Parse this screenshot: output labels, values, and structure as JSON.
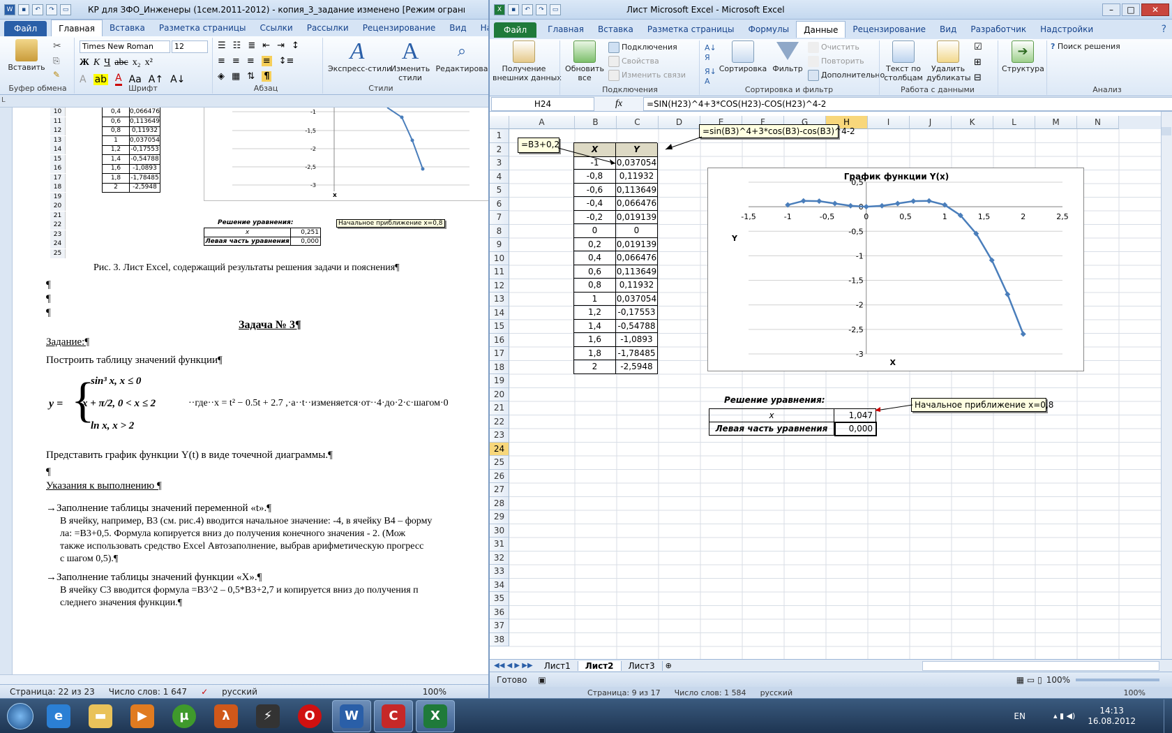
{
  "word": {
    "title": "КР для ЗФО_Инженеры (1сем.2011-2012) - копия_3_задание изменено [Режим ограниченной ...",
    "tabs": [
      "Файл",
      "Главная",
      "Вставка",
      "Разметка страницы",
      "Ссылки",
      "Рассылки",
      "Рецензирование",
      "Вид",
      "Надстр"
    ],
    "ribbon": {
      "paste": "Вставить",
      "clipboard": "Буфер обмена",
      "font_name": "Times New Roman",
      "font_size": "12",
      "font_group": "Шрифт",
      "para_group": "Абзац",
      "styles_group": "Стили",
      "express_styles": "Экспресс-стили",
      "change_styles_l1": "Изменить",
      "change_styles_l2": "стили",
      "editing": "Редактирова"
    },
    "mini_table": [
      [
        "10",
        "0,4",
        "0,066476"
      ],
      [
        "11",
        "0,6",
        "0,113649"
      ],
      [
        "12",
        "0,8",
        "0,11932"
      ],
      [
        "13",
        "1",
        "0,037054"
      ],
      [
        "14",
        "1,2",
        "-0,17553"
      ],
      [
        "15",
        "1,4",
        "-0,54788"
      ],
      [
        "16",
        "1,6",
        "-1,0893"
      ],
      [
        "17",
        "1,8",
        "-1,78485"
      ],
      [
        "18",
        "2",
        "-2,5948"
      ]
    ],
    "mini_rows_extra": [
      "19",
      "20",
      "21",
      "22",
      "23",
      "24",
      "25"
    ],
    "mini_chart": {
      "ticks": [
        "-1",
        "-1,5",
        "-2",
        "-2,5",
        "-3"
      ],
      "xlabel": "x"
    },
    "mini_solution": {
      "title": "Решение уравнения:",
      "x_label": "x",
      "x_val": "0,251",
      "lhs_label": "Левая часть уравнения",
      "lhs_val": "0,000",
      "comment": "Начальное приближение x=0,8"
    },
    "caption": "Рис. 3. Лист Excel, содержащий результаты решения задачи и пояснения¶",
    "pilcrow": "¶",
    "task_title": "Задача № 3¶",
    "assignment": "Задание:¶",
    "build_table": "Построить таблицу значений функции¶",
    "formula": {
      "y": "y =",
      "case1": "sin³ x,   x ≤ 0",
      "case2": "x + π/2,   0 < x ≤ 2",
      "case3": "ln  x,   x > 2",
      "where": "··где··x = t² − 0.5t + 2.7 ,·а··t··изменяется·от··4·до·2·с·шагом·0"
    },
    "plot_text": "Представить график функции Y(t) в виде точечной диаграммы.¶",
    "instructions": "Указания к выполнению ¶",
    "step1": [
      "→Заполнение таблицы значений переменной «t».¶",
      "В ячейку, например, В3 (см. рис.4) вводится начальное значение: -4, в ячейку В4 – форму",
      "ла: =B3+0,5. Формула копируется вниз до получения конечного значения - 2. (Мож",
      "также использовать средство Excel Автозаполнение, выбрав арифметическую прогресс",
      "с шагом 0,5).¶"
    ],
    "step2": [
      "→Заполнение таблицы значений функции «X».¶",
      "В ячейку С3 вводится формула =B3^2 – 0,5*B3+2,7 и копируется вниз до получения п",
      "следнего значения функции.¶"
    ],
    "status": {
      "page": "Страница: 22 из 23",
      "words": "Число слов: 1 647",
      "lang": "русский",
      "zoom": "100%"
    },
    "status_behind": {
      "page": "Страница: 9 из 17",
      "words": "Число слов: 1 584",
      "lang": "русский",
      "zoom": "100%"
    }
  },
  "excel": {
    "title": "Лист Microsoft Excel  -  Microsoft Excel",
    "tabs": [
      "Файл",
      "Главная",
      "Вставка",
      "Разметка страницы",
      "Формулы",
      "Данные",
      "Рецензирование",
      "Вид",
      "Разработчик",
      "Надстройки"
    ],
    "ribbon": {
      "get_data_l1": "Получение",
      "get_data_l2": "внешних данных",
      "refresh_l1": "Обновить",
      "refresh_l2": "все",
      "connections": "Подключения",
      "properties": "Свойства",
      "edit_links": "Изменить связи",
      "conn_group": "Подключения",
      "sort": "Сортировка",
      "filter": "Фильтр",
      "clear": "Очистить",
      "reapply": "Повторить",
      "advanced": "Дополнительно",
      "sort_group": "Сортировка и фильтр",
      "text_to_cols_l1": "Текст по",
      "text_to_cols_l2": "столбцам",
      "remove_dup_l1": "Удалить",
      "remove_dup_l2": "дубликаты",
      "data_tools": "Работа с данными",
      "outline": "Структура",
      "solver": "Поиск решения",
      "analysis": "Анализ"
    },
    "name_box": "H24",
    "fx": "fx",
    "formula": "=SIN(H23)^4+3*COS(H23)-COS(H23)^4-2",
    "columns": [
      "A",
      "B",
      "C",
      "D",
      "E",
      "F",
      "G",
      "H",
      "I",
      "J",
      "K",
      "L",
      "M",
      "N"
    ],
    "rows": [
      "1",
      "2",
      "3",
      "4",
      "5",
      "6",
      "7",
      "8",
      "9",
      "10",
      "11",
      "12",
      "13",
      "14",
      "15",
      "16",
      "17",
      "18",
      "19",
      "20",
      "21",
      "22",
      "23",
      "24",
      "25",
      "26",
      "27",
      "28",
      "29",
      "30",
      "31",
      "32",
      "33",
      "34",
      "35",
      "36",
      "37",
      "38"
    ],
    "table_header": {
      "x": "X",
      "y": "Y"
    },
    "table": [
      [
        "-1",
        "0,037054"
      ],
      [
        "-0,8",
        "0,11932"
      ],
      [
        "-0,6",
        "0,113649"
      ],
      [
        "-0,4",
        "0,066476"
      ],
      [
        "-0,2",
        "0,019139"
      ],
      [
        "0",
        "0"
      ],
      [
        "0,2",
        "0,019139"
      ],
      [
        "0,4",
        "0,066476"
      ],
      [
        "0,6",
        "0,113649"
      ],
      [
        "0,8",
        "0,11932"
      ],
      [
        "1",
        "0,037054"
      ],
      [
        "1,2",
        "-0,17553"
      ],
      [
        "1,4",
        "-0,54788"
      ],
      [
        "1,6",
        "-1,0893"
      ],
      [
        "1,8",
        "-1,78485"
      ],
      [
        "2",
        "-2,5948"
      ]
    ],
    "comment_b": "=B3+0,2",
    "comment_c": "=sin(B3)^4+3*cos(B3)-cos(B3)^4-2",
    "solution": {
      "title": "Решение уравнения:",
      "x_label": "x",
      "x_val": "1,047",
      "lhs_label": "Левая часть уравнения",
      "lhs_val": "0,000",
      "comment": "Начальное приближение x=0,8"
    },
    "sheets": [
      "Лист1",
      "Лист2",
      "Лист3"
    ],
    "status": "Готово",
    "zoom": "100%"
  },
  "chart_data": {
    "type": "scatter",
    "title": "График функции Y(x)",
    "xlabel": "X",
    "ylabel": "Y",
    "xlim": [
      -1.5,
      2.5
    ],
    "ylim": [
      -3,
      0.5
    ],
    "x_ticks": [
      "-1,5",
      "-1",
      "-0,5",
      "0",
      "0,5",
      "1",
      "1,5",
      "2",
      "2,5"
    ],
    "y_ticks": [
      "0,5",
      "0",
      "-0,5",
      "-1",
      "-1,5",
      "-2",
      "-2,5",
      "-3"
    ],
    "x": [
      -1,
      -0.8,
      -0.6,
      -0.4,
      -0.2,
      0,
      0.2,
      0.4,
      0.6,
      0.8,
      1,
      1.2,
      1.4,
      1.6,
      1.8,
      2
    ],
    "y": [
      0.037054,
      0.11932,
      0.113649,
      0.066476,
      0.019139,
      0,
      0.019139,
      0.066476,
      0.113649,
      0.11932,
      0.037054,
      -0.17553,
      -0.54788,
      -1.0893,
      -1.78485,
      -2.5948
    ],
    "series_color": "#4a7ebb",
    "grid": true
  },
  "taskbar": {
    "lang": "EN",
    "time": "14:13",
    "date": "16.08.2012"
  }
}
